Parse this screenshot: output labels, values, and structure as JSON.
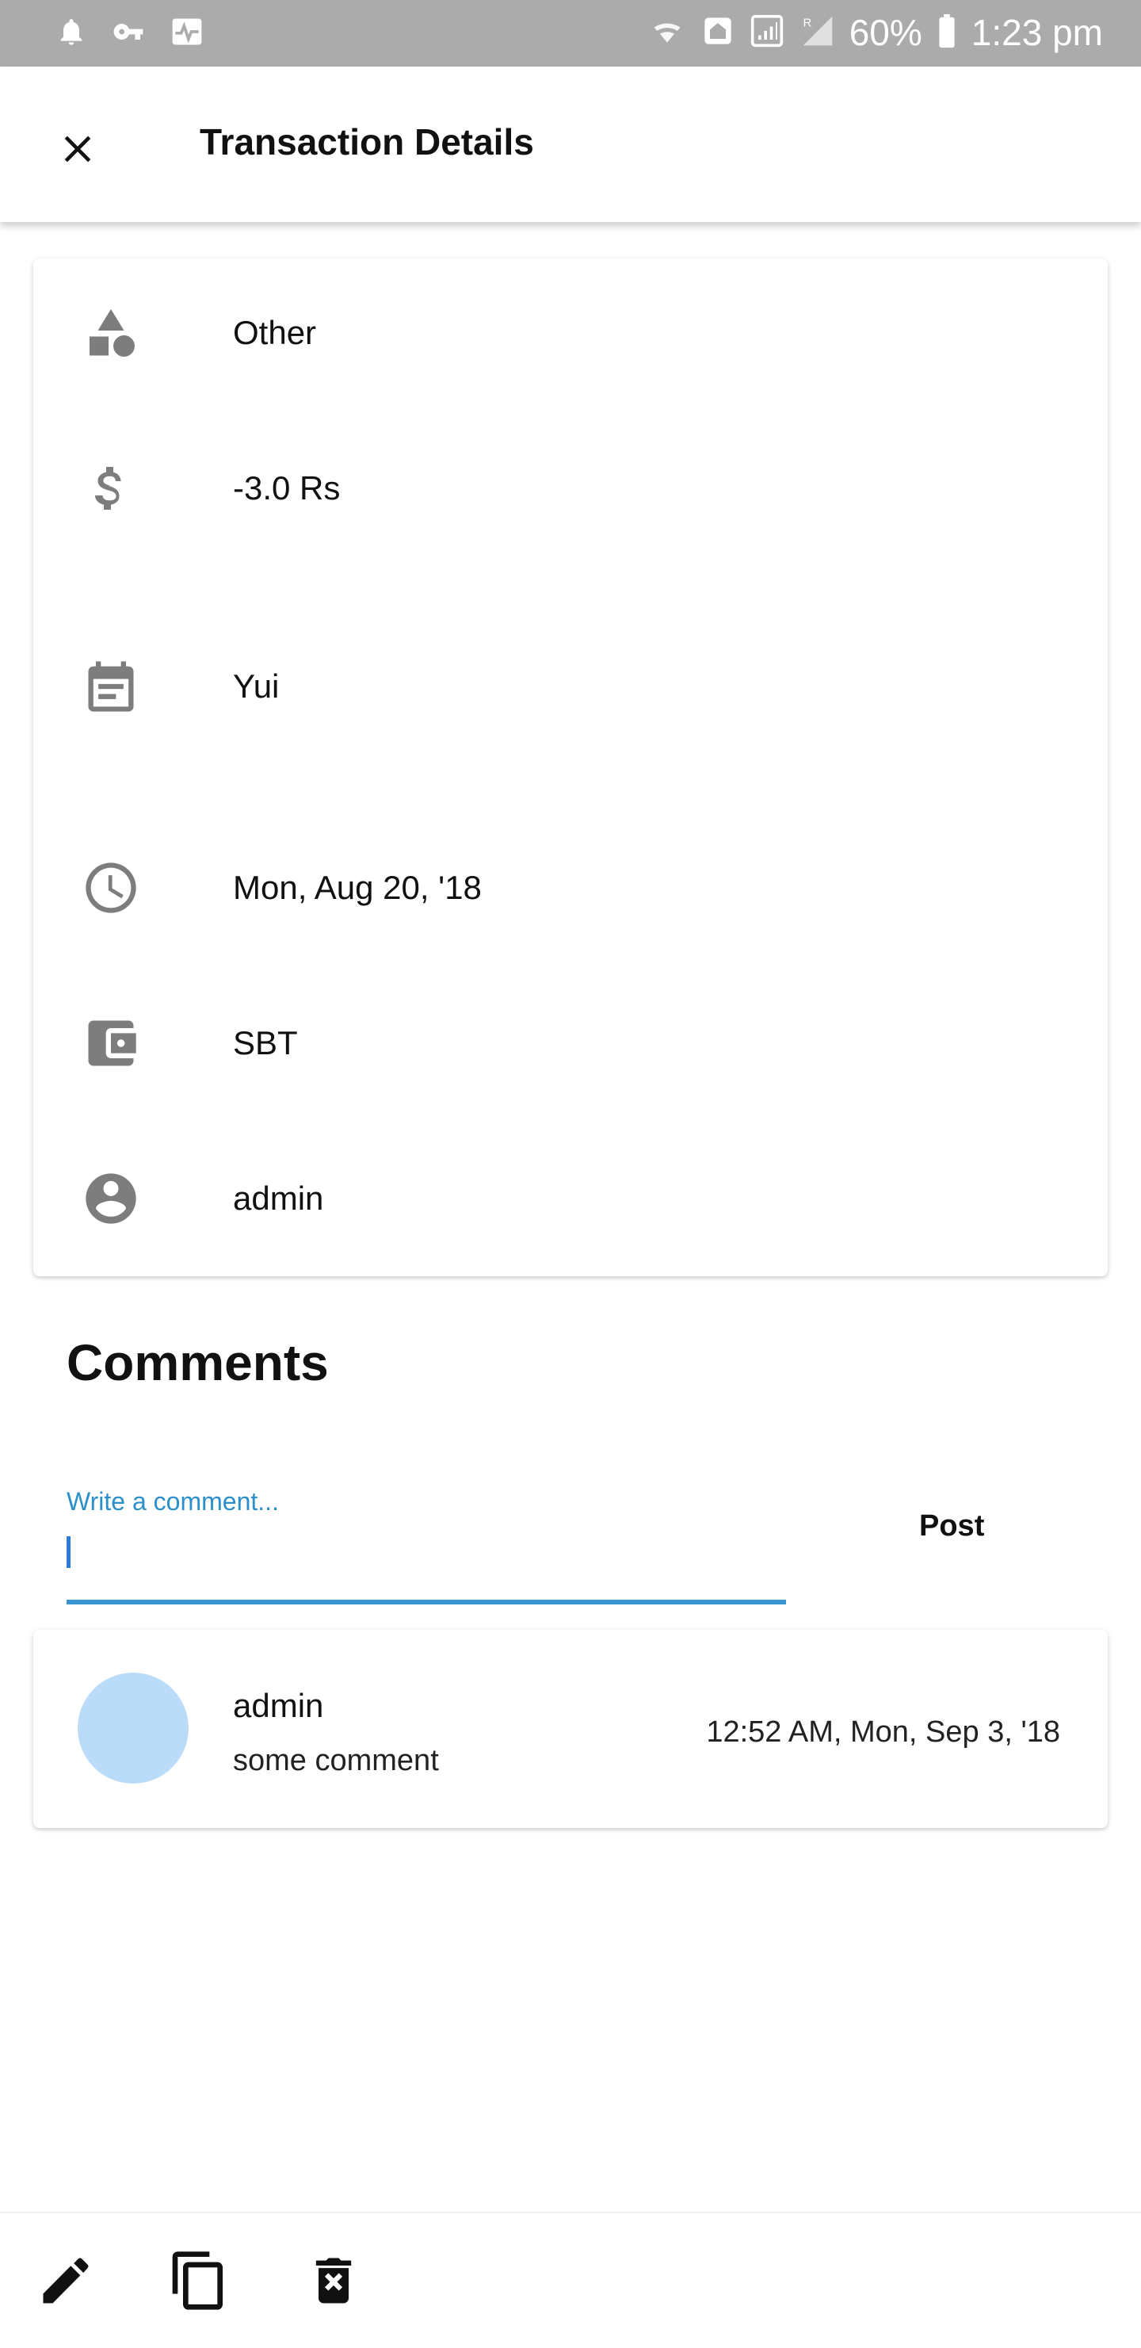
{
  "status_bar": {
    "battery": "60%",
    "time": "1:23 pm",
    "icons_left": [
      "bell-icon",
      "key-icon",
      "activity-icon"
    ],
    "icons_right": [
      "wifi-icon",
      "home-icon",
      "signal-icon",
      "roaming-signal-icon",
      "battery-icon"
    ]
  },
  "app_bar": {
    "title": "Transaction Details",
    "close_icon": "close-icon"
  },
  "details": [
    {
      "icon": "category-icon",
      "value": "Other"
    },
    {
      "icon": "dollar-icon",
      "value": "-3.0 Rs"
    },
    {
      "icon": "note-icon",
      "value": "Yui"
    },
    {
      "icon": "clock-icon",
      "value": "Mon, Aug 20, '18"
    },
    {
      "icon": "wallet-icon",
      "value": "SBT"
    },
    {
      "icon": "account-icon",
      "value": "admin"
    }
  ],
  "comments": {
    "heading": "Comments",
    "input_label": "Write a comment...",
    "input_value": "",
    "post_label": "Post",
    "items": [
      {
        "author": "admin",
        "text": "some comment",
        "time": "12:52 AM, Mon, Sep 3, '18",
        "avatar_color": "#bbdcf8"
      }
    ]
  },
  "bottom_actions": [
    "edit-icon",
    "copy-icon",
    "delete-icon"
  ],
  "colors": {
    "status_bar": "#ababab",
    "accent": "#3a95cf",
    "icon_gray": "#7d7d7d"
  }
}
